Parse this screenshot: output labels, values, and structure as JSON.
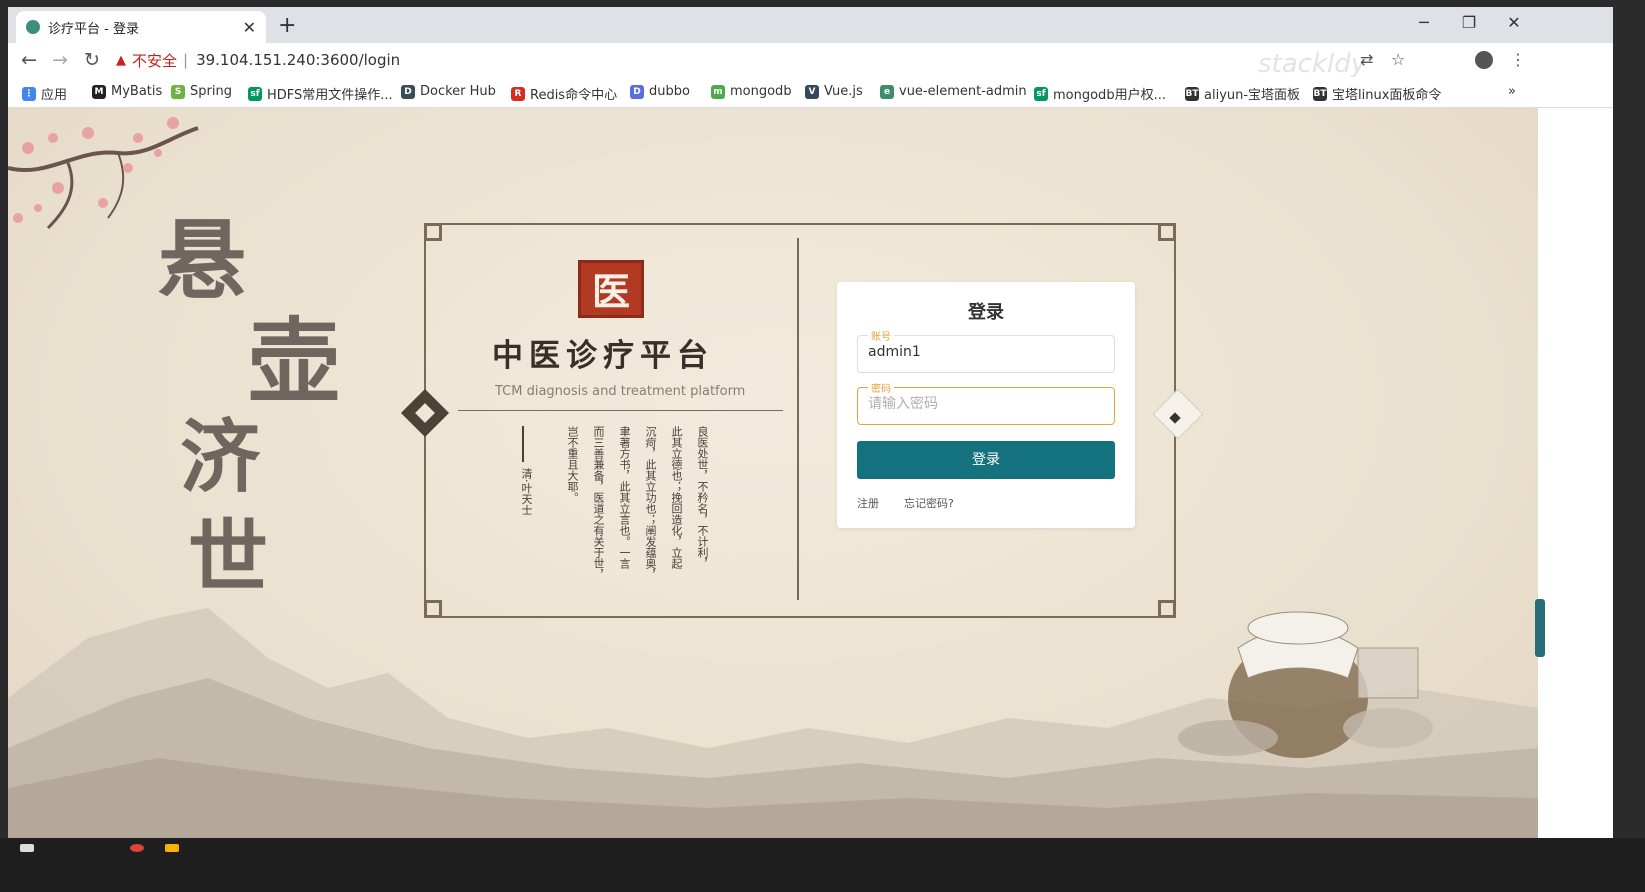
{
  "browser": {
    "tab_title": "诊疗平台 - 登录",
    "tab_close": "✕",
    "new_tab": "+",
    "window_controls": {
      "minimize": "─",
      "restore": "❐",
      "close": "✕"
    },
    "back": "←",
    "forward": "→",
    "reload": "↻",
    "security_icon": "▲",
    "security_label": "不安全",
    "separator": "|",
    "url": "39.104.151.240:3600/login",
    "toolbar_icons": {
      "translate": "⇄",
      "star": "☆",
      "menu": "⋮"
    },
    "watermark": "stackldy"
  },
  "bookmarks": [
    {
      "label": "应用",
      "icon": "apps-grid-icon",
      "color": "#4285f4",
      "glyph": "⋮"
    },
    {
      "label": "MyBatis",
      "icon": "mybatis-icon",
      "color": "#222222",
      "glyph": "M"
    },
    {
      "label": "Spring",
      "icon": "spring-icon",
      "color": "#6db33f",
      "glyph": "S"
    },
    {
      "label": "HDFS常用文件操作...",
      "icon": "segmentfault-icon",
      "color": "#009a61",
      "glyph": "sf"
    },
    {
      "label": "Docker Hub",
      "icon": "docker-icon",
      "color": "#394d54",
      "glyph": "D"
    },
    {
      "label": "Redis命令中心",
      "icon": "redis-icon",
      "color": "#d82c20",
      "glyph": "R"
    },
    {
      "label": "dubbo",
      "icon": "dubbo-icon",
      "color": "#5b6ee1",
      "glyph": "D"
    },
    {
      "label": "mongodb",
      "icon": "mongodb-icon",
      "color": "#4fa94d",
      "glyph": "m"
    },
    {
      "label": "Vue.js",
      "icon": "vue-icon",
      "color": "#35495e",
      "glyph": "V"
    },
    {
      "label": "vue-element-admin",
      "icon": "vue-element-admin-icon",
      "color": "#3c8d6b",
      "glyph": "e"
    },
    {
      "label": "mongodb用户权...",
      "icon": "segmentfault-icon",
      "color": "#009a61",
      "glyph": "sf"
    },
    {
      "label": "aliyun-宝塔面板",
      "icon": "bt-icon",
      "color": "#333333",
      "glyph": "BT"
    },
    {
      "label": "宝塔linux面板命令",
      "icon": "bt-icon",
      "color": "#333333",
      "glyph": "BT"
    }
  ],
  "bookmarks_more": "»",
  "page": {
    "calligraphy": [
      "悬",
      "壶",
      "济",
      "世"
    ],
    "seal_char": "医",
    "platform_name": "中医诊疗平台",
    "platform_subtitle": "TCM diagnosis and treatment platform",
    "quote_columns": [
      "良医处世，不矜名，不计利，",
      "此其立德也；挽回造化，立起",
      "沉疴，此其立功也；阐发蕴奥，",
      "聿著方书，此其立言也。一言",
      "而三善兼备，医道之有关于世，",
      "岂不重且大耶。"
    ],
    "quote_author": "清·叶天士"
  },
  "login": {
    "title": "登录",
    "account_label": "账号",
    "account_value": "admin1",
    "password_label": "密码",
    "password_placeholder": "请输入密码",
    "submit": "登录",
    "register": "注册",
    "forgot": "忘记密码?"
  },
  "colors": {
    "primary_button": "#15727f",
    "focus_border": "#e6a23c",
    "frame": "#7b6a54",
    "seal": "#b23a22"
  }
}
